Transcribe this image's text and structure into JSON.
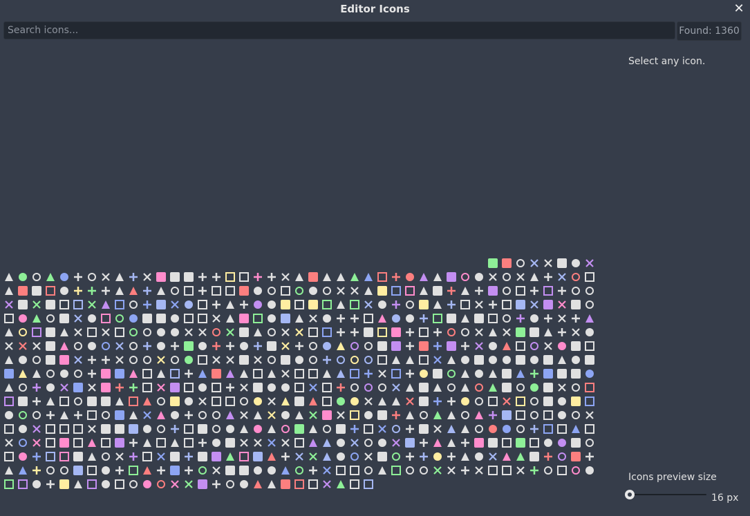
{
  "window": {
    "title": "Editor Icons",
    "close_glyph": "✕"
  },
  "search": {
    "placeholder": "Search icons...",
    "value": ""
  },
  "found_label": "Found: 1360",
  "detail": {
    "hint": "Select any icon."
  },
  "preview": {
    "label": "Icons preview size",
    "size_text": "16 px",
    "slider_fraction": 0.0
  },
  "icon_grid": {
    "palette": [
      "#e0e0e0",
      "#ff8ccc",
      "#8da5f3",
      "#8eef97",
      "#ffeda1",
      "#fc7f7f",
      "#a5b7f3",
      "#c38ef1"
    ],
    "icon_names": [
      "copy-icon",
      "cut-icon",
      "paste-icon",
      "add-icon",
      "move-icon",
      "anchor-icon",
      "node-icon",
      "folder-icon",
      "play-icon",
      "search-icon",
      "lock-icon",
      "music-icon",
      "gear-icon",
      "eye-icon",
      "close-icon",
      "warning-icon"
    ]
  }
}
